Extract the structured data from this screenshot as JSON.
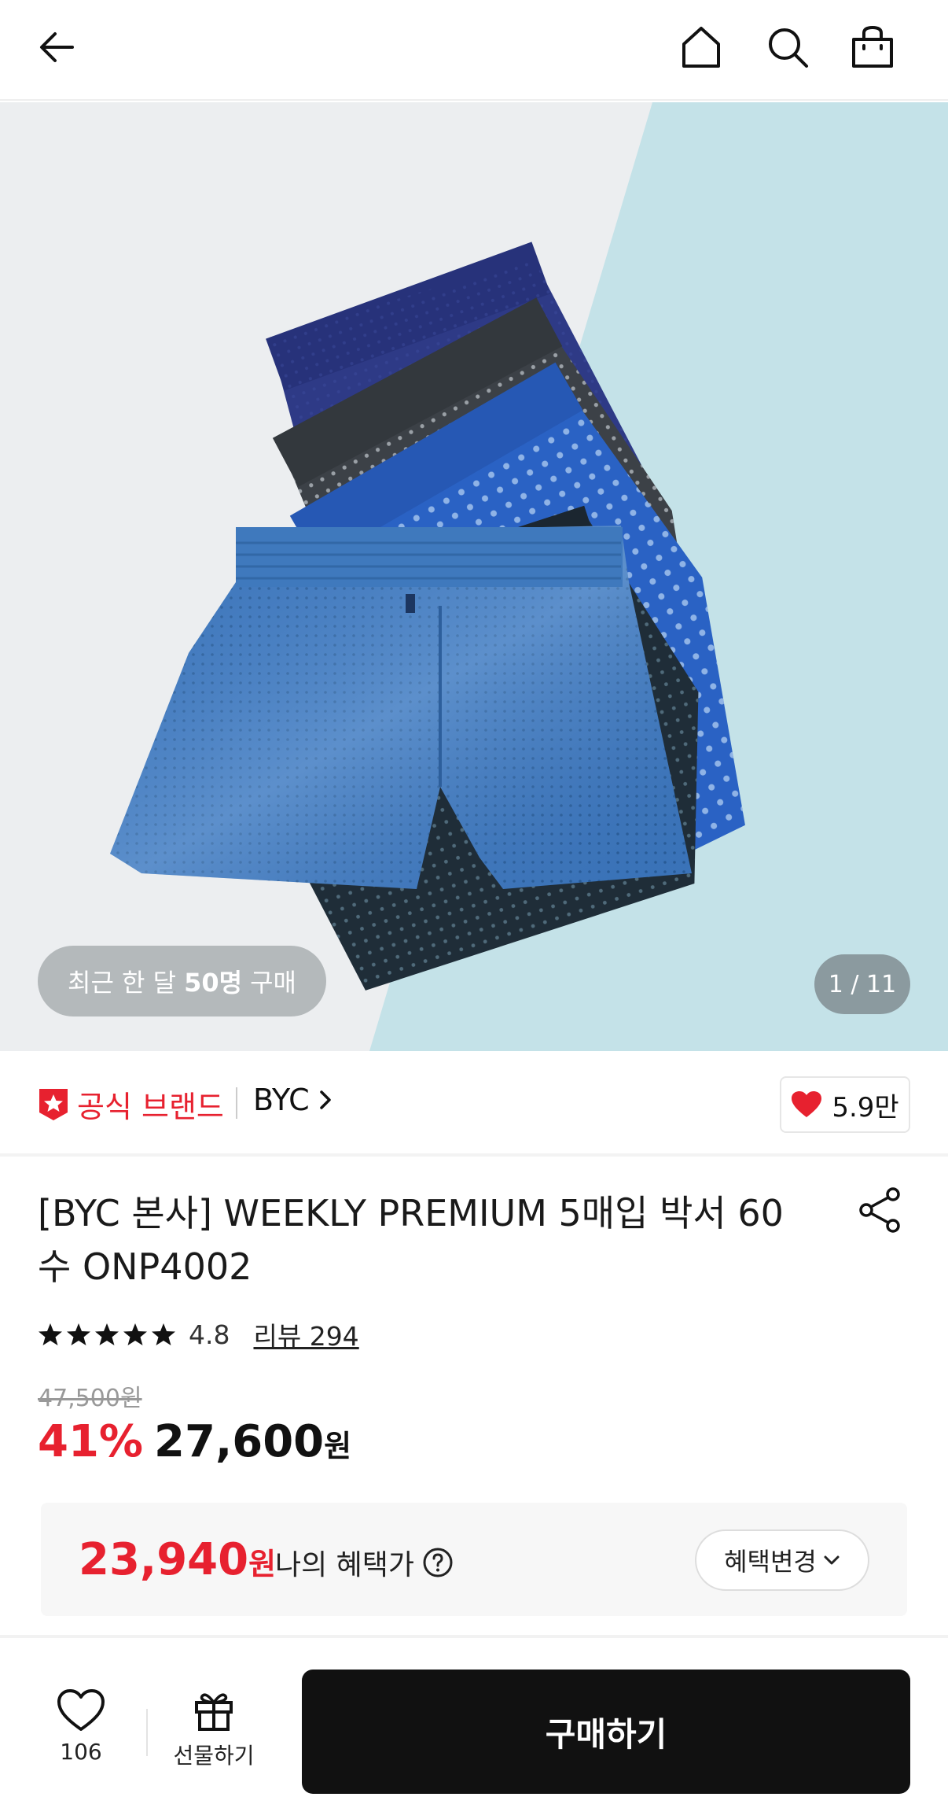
{
  "hero": {
    "recent_prefix": "최근 한 달",
    "recent_count": "50명",
    "recent_suffix": "구매",
    "counter": "1 / 11"
  },
  "brand": {
    "official_label": "공식 브랜드",
    "name": "BYC",
    "likes": "5.9만"
  },
  "product": {
    "title": "[BYC 본사] WEEKLY PREMIUM 5매입 박서 60수 ONP4002",
    "rating": "4.8",
    "reviews": "리뷰 294",
    "original_price": "47,500원",
    "discount": "41%",
    "price": "27,600",
    "price_unit": "원"
  },
  "benefit": {
    "price": "23,940",
    "price_unit": "원",
    "label": "나의 혜택가",
    "change_label": "혜택변경"
  },
  "bottom": {
    "wish_count": "106",
    "gift_label": "선물하기",
    "buy_label": "구매하기"
  },
  "colors": {
    "accent": "#e7212f",
    "buy_button": "#111111"
  }
}
